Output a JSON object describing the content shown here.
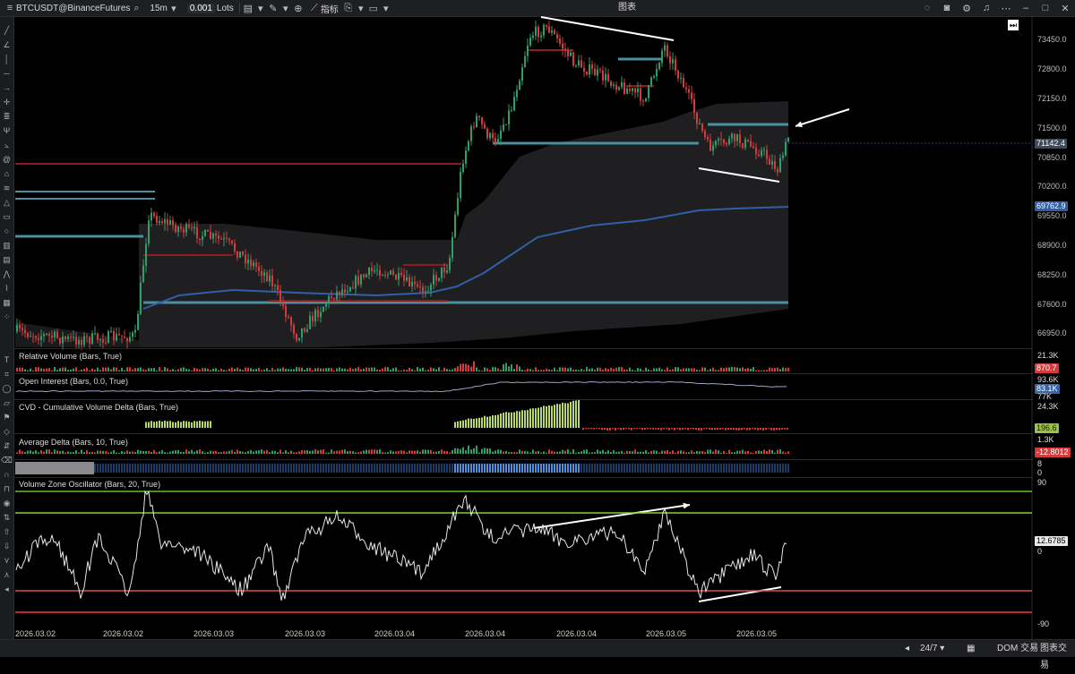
{
  "topbar": {
    "symbol": "BTCUSDT@BinanceFutures",
    "timeframe": "15m",
    "lots_value": "0.001",
    "lots_unit": "Lots",
    "indicators_label": "指标",
    "window_title": "图表"
  },
  "price_axis": {
    "ticks": [
      "73450.0",
      "72800.0",
      "72150.0",
      "71500.0",
      "70850.0",
      "70200.0",
      "69550.0",
      "68900.0",
      "68250.0",
      "67600.0",
      "66950.0"
    ],
    "current_price": "71142.4",
    "ma_price": "69762.9"
  },
  "panels": {
    "relative_volume": {
      "title": "Relative Volume (Bars, True)",
      "scale_top": "21.3K",
      "value": "870.7"
    },
    "open_interest": {
      "title": "Open Interest (Bars, 0.0, True)",
      "scale_top": "93.6K",
      "value": "83.1K",
      "scale_bottom": "77K"
    },
    "cvd": {
      "title": "CVD - Cumulative Volume Delta (Bars, True)",
      "scale_top": "24.3K",
      "value": "196.6"
    },
    "average_delta": {
      "title": "Average Delta (Bars, 10, True)",
      "scale_top": "1.3K",
      "value": "-12.8012"
    },
    "strip": {
      "scale_top": "8",
      "scale_bottom": "0"
    },
    "vzo": {
      "title": "Volume Zone Oscillator (Bars, 20, True)",
      "scale_top": "90",
      "value": "12.6785",
      "zero": "0",
      "scale_bottom": "-90"
    }
  },
  "date_axis": [
    "2026.03.02",
    "2026.03.02",
    "2026.03.03",
    "2026.03.03",
    "2026.03.04",
    "2026.03.04",
    "2026.03.04",
    "2026.03.05",
    "2026.03.05"
  ],
  "bottombar": {
    "session": "24/7",
    "dom_label": "DOM 交易",
    "chart_trade_label": "图表交易"
  },
  "colors": {
    "background": "#000000",
    "bull": "#2e9f6a",
    "bear": "#d23c3c",
    "zone_teal": "#4a8fa0",
    "zone_red": "#8e1c1c",
    "ma_blue": "#2f5fa8",
    "vzo_green": "#5cc33a",
    "vzo_red": "#c42626",
    "cvd_green": "#b9d86a"
  }
}
